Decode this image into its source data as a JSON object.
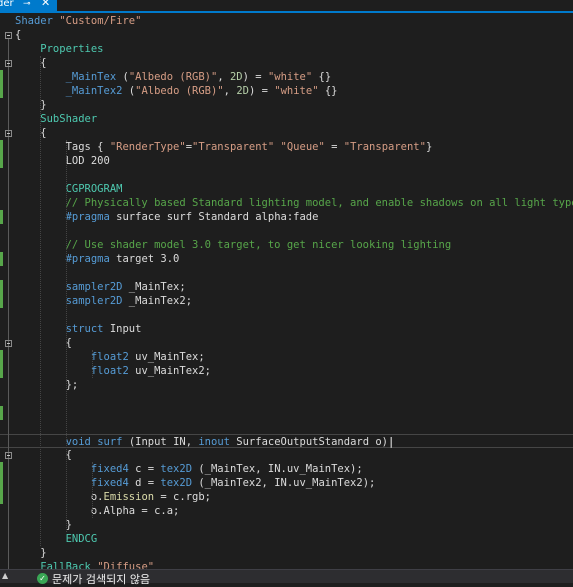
{
  "tab": {
    "label": "der",
    "pin": "⊸",
    "close": "✕"
  },
  "code_lines": [
    [
      {
        "t": "Shader ",
        "c": "keyword"
      },
      {
        "t": "\"Custom/Fire\"",
        "c": "string"
      }
    ],
    [
      {
        "t": "{",
        "c": "plain"
      }
    ],
    [
      {
        "t": "    Properties",
        "c": "section"
      }
    ],
    [
      {
        "t": "    {",
        "c": "plain"
      }
    ],
    [
      {
        "t": "        ",
        "c": "plain"
      },
      {
        "t": "_MainTex",
        "c": "prop"
      },
      {
        "t": " (",
        "c": "plain"
      },
      {
        "t": "\"Albedo (RGB)\"",
        "c": "string"
      },
      {
        "t": ", ",
        "c": "plain"
      },
      {
        "t": "2D",
        "c": "number"
      },
      {
        "t": ") = ",
        "c": "plain"
      },
      {
        "t": "\"white\"",
        "c": "string"
      },
      {
        "t": " {}",
        "c": "plain"
      }
    ],
    [
      {
        "t": "        ",
        "c": "plain"
      },
      {
        "t": "_MainTex2",
        "c": "prop"
      },
      {
        "t": " (",
        "c": "plain"
      },
      {
        "t": "\"Albedo (RGB)\"",
        "c": "string"
      },
      {
        "t": ", ",
        "c": "plain"
      },
      {
        "t": "2D",
        "c": "number"
      },
      {
        "t": ") = ",
        "c": "plain"
      },
      {
        "t": "\"white\"",
        "c": "string"
      },
      {
        "t": " {}",
        "c": "plain"
      }
    ],
    [
      {
        "t": "    }",
        "c": "plain"
      }
    ],
    [
      {
        "t": "    SubShader",
        "c": "section"
      }
    ],
    [
      {
        "t": "    {",
        "c": "plain"
      }
    ],
    [
      {
        "t": "        Tags { ",
        "c": "plain"
      },
      {
        "t": "\"RenderType\"",
        "c": "string"
      },
      {
        "t": "=",
        "c": "plain"
      },
      {
        "t": "\"Transparent\"",
        "c": "string"
      },
      {
        "t": " ",
        "c": "plain"
      },
      {
        "t": "\"Queue\"",
        "c": "string"
      },
      {
        "t": " = ",
        "c": "plain"
      },
      {
        "t": "\"Transparent\"",
        "c": "string"
      },
      {
        "t": "}",
        "c": "plain"
      }
    ],
    [
      {
        "t": "        LOD ",
        "c": "plain"
      },
      {
        "t": "200",
        "c": "plain"
      }
    ],
    [
      {
        "t": "",
        "c": "plain"
      }
    ],
    [
      {
        "t": "        CGPROGRAM",
        "c": "section"
      }
    ],
    [
      {
        "t": "        // Physically based Standard lighting model, and enable shadows on all light types",
        "c": "comment"
      }
    ],
    [
      {
        "t": "        ",
        "c": "plain"
      },
      {
        "t": "#pragma",
        "c": "keyword"
      },
      {
        "t": " surface surf Standard alpha:fade",
        "c": "plain"
      }
    ],
    [
      {
        "t": "",
        "c": "plain"
      }
    ],
    [
      {
        "t": "        // Use shader model 3.0 target, to get nicer looking lighting",
        "c": "comment"
      }
    ],
    [
      {
        "t": "        ",
        "c": "plain"
      },
      {
        "t": "#pragma",
        "c": "keyword"
      },
      {
        "t": " target 3.0",
        "c": "plain"
      }
    ],
    [
      {
        "t": "",
        "c": "plain"
      }
    ],
    [
      {
        "t": "        ",
        "c": "plain"
      },
      {
        "t": "sampler2D",
        "c": "keyword"
      },
      {
        "t": " _MainTex;",
        "c": "plain"
      }
    ],
    [
      {
        "t": "        ",
        "c": "plain"
      },
      {
        "t": "sampler2D",
        "c": "keyword"
      },
      {
        "t": " _MainTex2;",
        "c": "plain"
      }
    ],
    [
      {
        "t": "",
        "c": "plain"
      }
    ],
    [
      {
        "t": "        ",
        "c": "plain"
      },
      {
        "t": "struct",
        "c": "keyword"
      },
      {
        "t": " Input",
        "c": "plain"
      }
    ],
    [
      {
        "t": "        {",
        "c": "plain"
      }
    ],
    [
      {
        "t": "            ",
        "c": "plain"
      },
      {
        "t": "float2",
        "c": "keyword"
      },
      {
        "t": " uv_MainTex;",
        "c": "plain"
      }
    ],
    [
      {
        "t": "            ",
        "c": "plain"
      },
      {
        "t": "float2",
        "c": "keyword"
      },
      {
        "t": " uv_MainTex2;",
        "c": "plain"
      }
    ],
    [
      {
        "t": "        };",
        "c": "plain"
      }
    ],
    [
      {
        "t": "",
        "c": "plain"
      }
    ],
    [
      {
        "t": "",
        "c": "plain"
      }
    ],
    [
      {
        "t": "",
        "c": "plain"
      }
    ],
    [
      {
        "t": "        ",
        "c": "plain"
      },
      {
        "t": "void",
        "c": "keyword"
      },
      {
        "t": " ",
        "c": "plain"
      },
      {
        "t": "surf",
        "c": "keyword"
      },
      {
        "t": " (Input IN, ",
        "c": "plain"
      },
      {
        "t": "inout",
        "c": "keyword"
      },
      {
        "t": " SurfaceOutputStandard o)",
        "c": "plain"
      },
      {
        "t": "|",
        "c": "caret"
      }
    ],
    [
      {
        "t": "        {",
        "c": "plain"
      }
    ],
    [
      {
        "t": "            ",
        "c": "plain"
      },
      {
        "t": "fixed4",
        "c": "keyword"
      },
      {
        "t": " c = ",
        "c": "plain"
      },
      {
        "t": "tex2D",
        "c": "keyword"
      },
      {
        "t": " (_MainTex, IN.uv_MainTex);",
        "c": "plain"
      }
    ],
    [
      {
        "t": "            ",
        "c": "plain"
      },
      {
        "t": "fixed4",
        "c": "keyword"
      },
      {
        "t": " d = ",
        "c": "plain"
      },
      {
        "t": "tex2D",
        "c": "keyword"
      },
      {
        "t": " (_MainTex2, IN.uv_MainTex2);",
        "c": "plain"
      }
    ],
    [
      {
        "t": "            o.",
        "c": "plain"
      },
      {
        "t": "Emission",
        "c": "yellow"
      },
      {
        "t": " = c.rgb;",
        "c": "plain"
      }
    ],
    [
      {
        "t": "            o.Alpha = c.a;",
        "c": "plain"
      }
    ],
    [
      {
        "t": "        }",
        "c": "plain"
      }
    ],
    [
      {
        "t": "        ENDCG",
        "c": "section"
      }
    ],
    [
      {
        "t": "    }",
        "c": "plain"
      }
    ],
    [
      {
        "t": "    FallBack ",
        "c": "section"
      },
      {
        "t": "\"Diffuse\"",
        "c": "string"
      }
    ],
    [
      {
        "t": "}",
        "c": "plain"
      }
    ]
  ],
  "status": {
    "arrow": "▲",
    "icon": "check-circle-icon",
    "text": "문제가 검색되지 않음"
  },
  "colors": {
    "accent": "#007acc",
    "change_marker": "#57a64a",
    "background": "#1e1e1e"
  }
}
